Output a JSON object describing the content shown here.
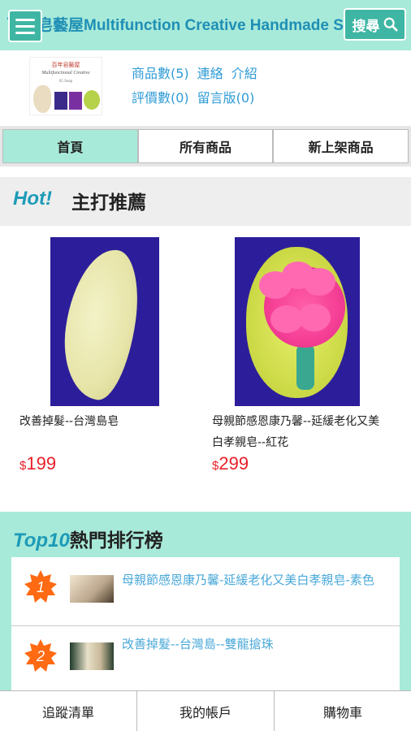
{
  "header": {
    "title": "百年皂藝屋Multifunction Creative Handmade Soap",
    "search_label": "搜尋",
    "accent_color": "#a8ead9",
    "button_color": "#3fb6a3"
  },
  "store": {
    "logo_zh": "百年皂藝屋",
    "logo_en": "Multifunctional Creative",
    "logo_sub": "65 Soap",
    "links": {
      "products": "商品數(5)",
      "contact": "連絡",
      "about": "介紹",
      "reviews": "評價數(0)",
      "guestbook": "留言版(0)"
    }
  },
  "tabs": [
    {
      "label": "首頁",
      "active": true
    },
    {
      "label": "所有商品",
      "active": false
    },
    {
      "label": "新上架商品",
      "active": false
    }
  ],
  "hot": {
    "tag": "Hot!",
    "title": "主打推薦",
    "products": [
      {
        "name": "改善掉髮--台灣島皂",
        "currency": "$",
        "price": "199"
      },
      {
        "name": "母親節感恩康乃馨--延緩老化又美白孝親皂--紅花",
        "currency": "$",
        "price": "299"
      }
    ]
  },
  "top10": {
    "tag": "Top10",
    "title": "熱門排行榜",
    "items": [
      {
        "rank": "1",
        "name": "母親節感恩康乃馨-延緩老化又美白孝親皂-素色"
      },
      {
        "rank": "2",
        "name": "改善掉髮--台灣島--雙龍搶珠"
      }
    ]
  },
  "bottom_nav": {
    "watchlist": "追蹤清單",
    "account": "我的帳戶",
    "cart": "購物車"
  },
  "icons": {
    "menu": "hamburger-menu-icon",
    "search": "magnifier-search-icon",
    "rank_badge": "orange-starburst-badge"
  }
}
